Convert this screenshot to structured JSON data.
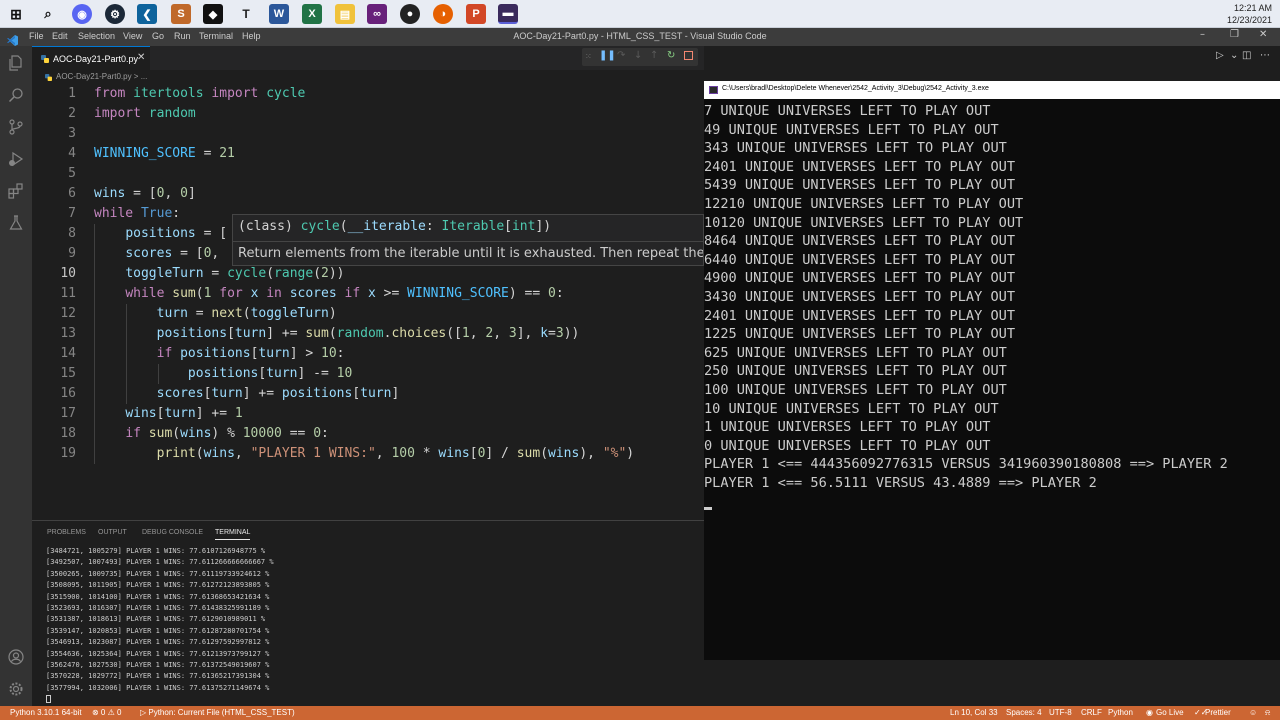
{
  "taskbar": {
    "clock_time": "12:21 AM",
    "clock_date": "12/23/2021"
  },
  "window": {
    "title": "AOC-Day21-Part0.py - HTML_CSS_TEST - Visual Studio Code",
    "menu": [
      "File",
      "Edit",
      "Selection",
      "View",
      "Go",
      "Run",
      "Terminal",
      "Help"
    ]
  },
  "editor": {
    "tab_label": "AOC-Day21-Part0.py",
    "breadcrumb": "AOC-Day21-Part0.py > ...",
    "line_numbers": [
      "1",
      "2",
      "3",
      "4",
      "5",
      "6",
      "7",
      "8",
      "9",
      "10",
      "11",
      "12",
      "13",
      "14",
      "15",
      "16",
      "17",
      "18",
      "19"
    ],
    "current_line": "10",
    "code": {
      "l1_from": "from",
      "l1_mod": "itertools",
      "l1_import": "import",
      "l1_name": "cycle",
      "l2_import": "import",
      "l2_mod": "random",
      "l4_const": "WINNING_SCORE",
      "l4_eq": " = ",
      "l4_val": "21",
      "l6_var": "wins",
      "l6_rest": " = [",
      "l6_n1": "0",
      "l6_comma": ", ",
      "l6_n2": "0",
      "l6_close": "]",
      "l7_while": "while",
      "l7_true": "True",
      "l7_colon": ":",
      "l8_var": "positions",
      "l8_rest": " = [",
      "l9_var": "scores",
      "l9_rest": " = [",
      "l9_n": "0",
      "l9_comma": ",",
      "l10_var": "toggleTurn",
      "l10_eq": " = ",
      "l10_cycle": "cycle",
      "l10_p": "(",
      "l10_range": "range",
      "l10_p2": "(",
      "l10_n": "2",
      "l10_close": "))",
      "l11_while": "while",
      "l11_sum": "sum",
      "l11_p": "(",
      "l11_n": "1",
      "l11_for": "for",
      "l11_x": "x",
      "l11_in": "in",
      "l11_scores": "scores",
      "l11_if": "if",
      "l11_x2": "x",
      "l11_ge": " >= ",
      "l11_const": "WINNING_SCORE",
      "l11_eq": ") == ",
      "l11_zero": "0",
      "l11_colon": ":",
      "l12_turn": "turn",
      "l12_eq": " = ",
      "l12_next": "next",
      "l12_p": "(",
      "l12_arg": "toggleTurn",
      "l12_close": ")",
      "l13_pos": "positions",
      "l13_b": "[",
      "l13_turn": "turn",
      "l13_op": "] += ",
      "l13_sum": "sum",
      "l13_p": "(",
      "l13_random": "random",
      "l13_dot": ".",
      "l13_choices": "choices",
      "l13_open": "([",
      "l13_n1": "1",
      "l13_c1": ", ",
      "l13_n2": "2",
      "l13_c2": ", ",
      "l13_n3": "3",
      "l13_mid": "], ",
      "l13_k": "k",
      "l13_eq": "=",
      "l13_kv": "3",
      "l13_close": "))",
      "l14_if": "if",
      "l14_pos": "positions",
      "l14_b": "[",
      "l14_turn": "turn",
      "l14_op": "] > ",
      "l14_n": "10",
      "l14_colon": ":",
      "l15_pos": "positions",
      "l15_b": "[",
      "l15_turn": "turn",
      "l15_op": "] -= ",
      "l15_n": "10",
      "l16_scores": "scores",
      "l16_b": "[",
      "l16_turn": "turn",
      "l16_op": "] += ",
      "l16_pos": "positions",
      "l16_b2": "[",
      "l16_turn2": "turn",
      "l16_close": "]",
      "l17_wins": "wins",
      "l17_b": "[",
      "l17_turn": "turn",
      "l17_op": "] += ",
      "l17_n": "1",
      "l18_if": "if",
      "l18_sum": "sum",
      "l18_p": "(",
      "l18_wins": "wins",
      "l18_op": ") % ",
      "l18_n": "10000",
      "l18_eq": " == ",
      "l18_zero": "0",
      "l18_colon": ":",
      "l19_print": "print",
      "l19_p": "(",
      "l19_wins": "wins",
      "l19_c": ", ",
      "l19_str": "\"PLAYER 1 WINS:\"",
      "l19_c2": ", ",
      "l19_n": "100",
      "l19_mul": " * ",
      "l19_wins2": "wins",
      "l19_b": "[",
      "l19_zero": "0",
      "l19_div": "] / ",
      "l19_sum": "sum",
      "l19_p2": "(",
      "l19_wins3": "wins",
      "l19_c3": "), ",
      "l19_pct": "\"%\"",
      "l19_close": ")"
    }
  },
  "hover": {
    "sig_open": "(class) ",
    "sig_name": "cycle",
    "sig_p": "(",
    "sig_param": "__iterable",
    "sig_colon": ": ",
    "sig_type": "Iterable",
    "sig_b": "[",
    "sig_int": "int",
    "sig_close": "])",
    "doc": "Return elements from the iterable until it is exhausted. Then repeat the s"
  },
  "panel": {
    "tabs": [
      "PROBLEMS",
      "OUTPUT",
      "DEBUG CONSOLE",
      "TERMINAL"
    ],
    "active_tab": "TERMINAL",
    "terminal_lines": [
      "[3484721, 1005279] PLAYER 1 WINS: 77.6107126948775 %",
      "[3492507, 1007493] PLAYER 1 WINS: 77.611266666666667 %",
      "[3500265, 1009735] PLAYER 1 WINS: 77.61119733924612 %",
      "[3508095, 1011905] PLAYER 1 WINS: 77.61272123893805 %",
      "[3515900, 1014100] PLAYER 1 WINS: 77.61368653421634 %",
      "[3523693, 1016307] PLAYER 1 WINS: 77.61438325991189 %",
      "[3531387, 1018613] PLAYER 1 WINS: 77.6129010989011 %",
      "[3539147, 1020853] PLAYER 1 WINS: 77.61287280701754 %",
      "[3546913, 1023087] PLAYER 1 WINS: 77.61297592997812 %",
      "[3554636, 1025364] PLAYER 1 WINS: 77.61213973799127 %",
      "[3562470, 1027530] PLAYER 1 WINS: 77.61372549019607 %",
      "[3570228, 1029772] PLAYER 1 WINS: 77.61365217391304 %",
      "[3577994, 1032006] PLAYER 1 WINS: 77.61375271149674 %"
    ]
  },
  "console": {
    "title": "C:\\Users\\bradl\\Desktop\\Delete Whenever\\2542_Activity_3\\Debug\\2542_Activity_3.exe",
    "lines": [
      "7 UNIQUE UNIVERSES LEFT TO PLAY OUT",
      "49 UNIQUE UNIVERSES LEFT TO PLAY OUT",
      "343 UNIQUE UNIVERSES LEFT TO PLAY OUT",
      "2401 UNIQUE UNIVERSES LEFT TO PLAY OUT",
      "5439 UNIQUE UNIVERSES LEFT TO PLAY OUT",
      "12210 UNIQUE UNIVERSES LEFT TO PLAY OUT",
      "10120 UNIQUE UNIVERSES LEFT TO PLAY OUT",
      "8464 UNIQUE UNIVERSES LEFT TO PLAY OUT",
      "6440 UNIQUE UNIVERSES LEFT TO PLAY OUT",
      "4900 UNIQUE UNIVERSES LEFT TO PLAY OUT",
      "3430 UNIQUE UNIVERSES LEFT TO PLAY OUT",
      "2401 UNIQUE UNIVERSES LEFT TO PLAY OUT",
      "1225 UNIQUE UNIVERSES LEFT TO PLAY OUT",
      "625 UNIQUE UNIVERSES LEFT TO PLAY OUT",
      "250 UNIQUE UNIVERSES LEFT TO PLAY OUT",
      "100 UNIQUE UNIVERSES LEFT TO PLAY OUT",
      "10 UNIQUE UNIVERSES LEFT TO PLAY OUT",
      "1 UNIQUE UNIVERSES LEFT TO PLAY OUT",
      "0 UNIQUE UNIVERSES LEFT TO PLAY OUT",
      "PLAYER 1 <== 444356092776315 VERSUS 341960390180808 ==> PLAYER 2",
      "PLAYER 1 <== 56.5111 VERSUS 43.4889 ==> PLAYER 2"
    ]
  },
  "statusbar": {
    "python_version": "Python 3.10.1 64-bit",
    "problems": "⊗ 0 ⚠ 0",
    "run_config": "▷ Python: Current File (HTML_CSS_TEST)",
    "cursor_pos": "Ln 10, Col 33",
    "spaces": "Spaces: 4",
    "encoding": "UTF-8",
    "eol": "CRLF",
    "language": "Python",
    "golive": "Go Live",
    "prettier": "Prettier"
  },
  "colors": {
    "statusbar": "#cc6633",
    "accent": "#0078d4"
  }
}
